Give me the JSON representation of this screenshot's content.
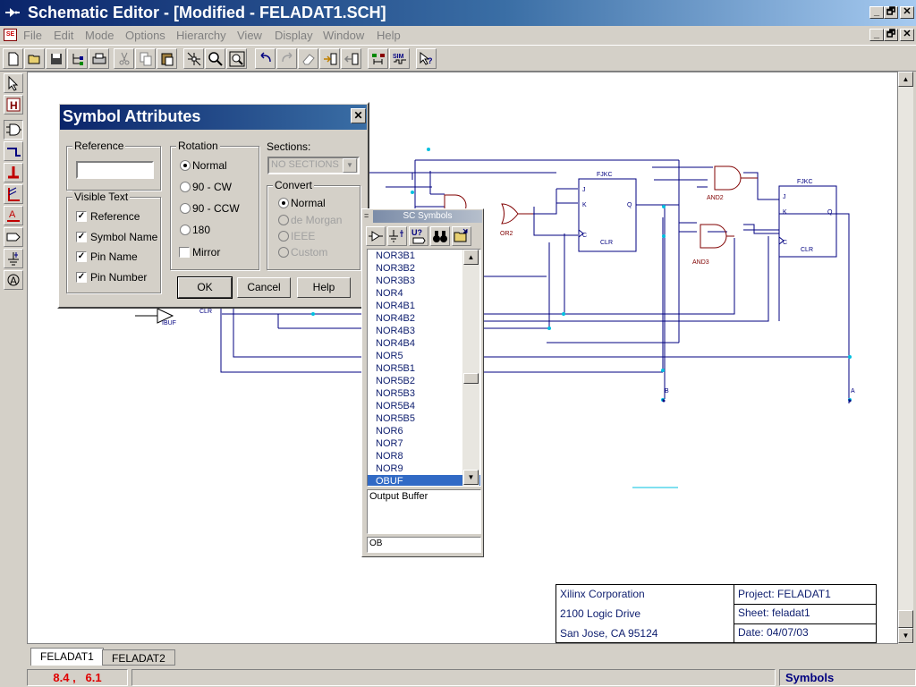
{
  "window": {
    "title": "Schematic Editor - [Modified - FELADAT1.SCH]",
    "controls": [
      "_",
      "🗗",
      "✕"
    ],
    "doc_controls": [
      "_",
      "🗗",
      "✕"
    ]
  },
  "menu": [
    "File",
    "Edit",
    "Mode",
    "Options",
    "Hierarchy",
    "View",
    "Display",
    "Window",
    "Help"
  ],
  "toolbar": {
    "buttons": [
      "new-icon",
      "open-icon",
      "save-icon",
      "hierarchy-icon",
      "print-icon",
      "cut-icon",
      "copy-icon",
      "paste-icon",
      "zoom-to-box-icon",
      "zoom-icon",
      "zoom-full-icon",
      "undo-icon",
      "redo-icon",
      "eraser-icon",
      "push-icon",
      "pop-icon",
      "netlist-icon",
      "sim-icon",
      "help-pointer-icon"
    ],
    "sim_label": "SIM"
  },
  "left_tools": [
    "select-arrow-icon",
    "hierarchy-h-icon",
    "symbol-gate-icon",
    "net-icon",
    "bus-icon",
    "bus-entry-icon",
    "label-a-icon",
    "io-marker-icon",
    "power-icon",
    "text-icon"
  ],
  "dialog": {
    "title": "Symbol Attributes",
    "reference_label": "Reference",
    "reference_value": "",
    "visible_text_label": "Visible Text",
    "visible_text": [
      {
        "label": "Reference",
        "checked": true
      },
      {
        "label": "Symbol Name",
        "checked": true
      },
      {
        "label": "Pin Name",
        "checked": true
      },
      {
        "label": "Pin Number",
        "checked": true
      }
    ],
    "rotation_label": "Rotation",
    "rotation_options": [
      {
        "label": "Normal",
        "selected": true
      },
      {
        "label": "90 - CW",
        "selected": false
      },
      {
        "label": "90 - CCW",
        "selected": false
      },
      {
        "label": "180",
        "selected": false
      }
    ],
    "mirror_label": "Mirror",
    "mirror_checked": false,
    "sections_label": "Sections:",
    "sections_value": "NO SECTIONS",
    "convert_label": "Convert",
    "convert_options": [
      {
        "label": "Normal",
        "selected": true,
        "enabled": true
      },
      {
        "label": "de Morgan",
        "selected": false,
        "enabled": false
      },
      {
        "label": "IEEE",
        "selected": false,
        "enabled": false
      },
      {
        "label": "Custom",
        "selected": false,
        "enabled": false
      }
    ],
    "ok_label": "OK",
    "cancel_label": "Cancel",
    "help_label": "Help"
  },
  "palette": {
    "title": "SC Symbols",
    "min_label": "=",
    "tools": [
      "buffer-icon",
      "ground-icon",
      "unknown-symbol-icon",
      "binoculars-icon",
      "open-folder-icon"
    ],
    "tool_text": "U?",
    "items": [
      "NOR3B1",
      "NOR3B2",
      "NOR3B3",
      "NOR4",
      "NOR4B1",
      "NOR4B2",
      "NOR4B3",
      "NOR4B4",
      "NOR5",
      "NOR5B1",
      "NOR5B2",
      "NOR5B3",
      "NOR5B4",
      "NOR5B5",
      "NOR6",
      "NOR7",
      "NOR8",
      "NOR9",
      "OBUF"
    ],
    "selected": "OBUF",
    "description": "Output Buffer",
    "field_value": "OB"
  },
  "schematic": {
    "labels": {
      "fjkc1": "FJKC",
      "fjkc2": "FJKC",
      "and2": "AND2",
      "and3": "AND3",
      "or2": "OR2",
      "ibuf": "IBUF",
      "clr": "CLR",
      "pin_j": "J",
      "pin_k": "K",
      "pin_q": "Q",
      "pin_c": "C",
      "port_b": "B",
      "port_a": "A"
    }
  },
  "title_block": {
    "company": "Xilinx Corporation",
    "street": "2100 Logic Drive",
    "city": "San Jose, CA 95124",
    "project": "Project: FELADAT1",
    "sheet": "Sheet: feladat1",
    "date": "Date: 04/07/03"
  },
  "tabs": [
    {
      "label": "FELADAT1",
      "active": true
    },
    {
      "label": "FELADAT2",
      "active": false
    }
  ],
  "status": {
    "coords": "8.4 ,   6.1",
    "mode": "Symbols"
  },
  "colors": {
    "wire": "#000080",
    "junction": "#00c0e0",
    "symbol": "#800000",
    "coords_text": "#e00000",
    "title_text": "#102070"
  }
}
